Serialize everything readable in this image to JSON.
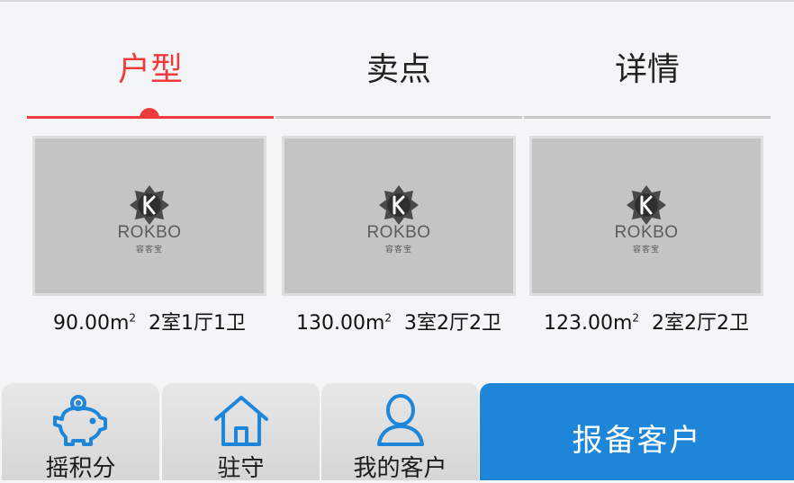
{
  "tabs": [
    {
      "label": "户型",
      "active": true
    },
    {
      "label": "卖点",
      "active": false
    },
    {
      "label": "详情",
      "active": false
    }
  ],
  "colors": {
    "accent": "#ef3b3b",
    "primary_button": "#1e86d8",
    "icon_blue": "#1e86d8",
    "placeholder_bg": "#c4c4c4"
  },
  "floor_plans": [
    {
      "area": "90.00m",
      "sup": "2",
      "rooms": "2室1厅1卫",
      "placeholder": {
        "brand": "ROKBO",
        "brand_sub": "容客宝",
        "icon": "rokbo-logo-icon"
      }
    },
    {
      "area": "130.00m",
      "sup": "2",
      "rooms": "3室2厅2卫",
      "placeholder": {
        "brand": "ROKBO",
        "brand_sub": "容客宝",
        "icon": "rokbo-logo-icon"
      }
    },
    {
      "area": "123.00m",
      "sup": "2",
      "rooms": "2室2厅2卫",
      "placeholder": {
        "brand": "ROKBO",
        "brand_sub": "容客宝",
        "icon": "rokbo-logo-icon"
      }
    }
  ],
  "bottom_nav": [
    {
      "label": "摇积分",
      "icon": "piggy-bank-icon"
    },
    {
      "label": "驻守",
      "icon": "house-icon"
    },
    {
      "label": "我的客户",
      "icon": "person-icon"
    }
  ],
  "report_button": {
    "label": "报备客户"
  }
}
